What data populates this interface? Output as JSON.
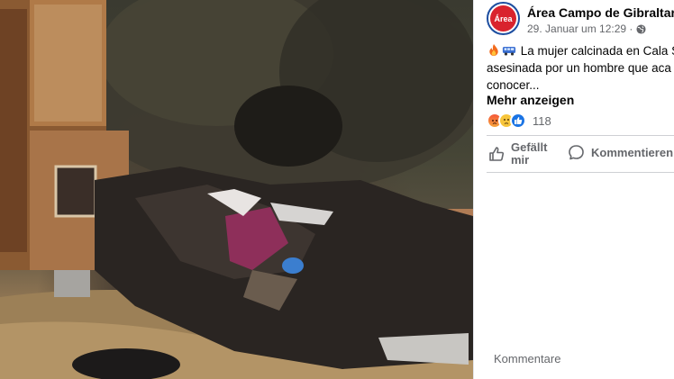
{
  "post": {
    "page_name": "Área Campo de Gibraltar",
    "avatar_text": "Área",
    "date": "29. Januar um 12:29 ·",
    "text_line1": "La mujer calcinada en Cala S",
    "text_line2": "asesinada por un hombre que aca",
    "text_line3": "conocer...",
    "see_more": "Mehr anzeigen",
    "reaction_count": "118"
  },
  "actions": {
    "like_label": "Gefällt mir",
    "comment_label": "Kommentieren"
  },
  "comments": {
    "label": "Kommentare"
  },
  "icons": [
    "fire-icon",
    "bus-icon",
    "globe-icon",
    "angry-reaction-icon",
    "sad-reaction-icon",
    "like-reaction-icon",
    "thumbs-up-icon",
    "comment-bubble-icon"
  ],
  "colors": {
    "brand_red": "#d9232d",
    "brand_blue": "#1d4ea0",
    "like_blue": "#1b74e4",
    "muted_text": "#65676b"
  }
}
